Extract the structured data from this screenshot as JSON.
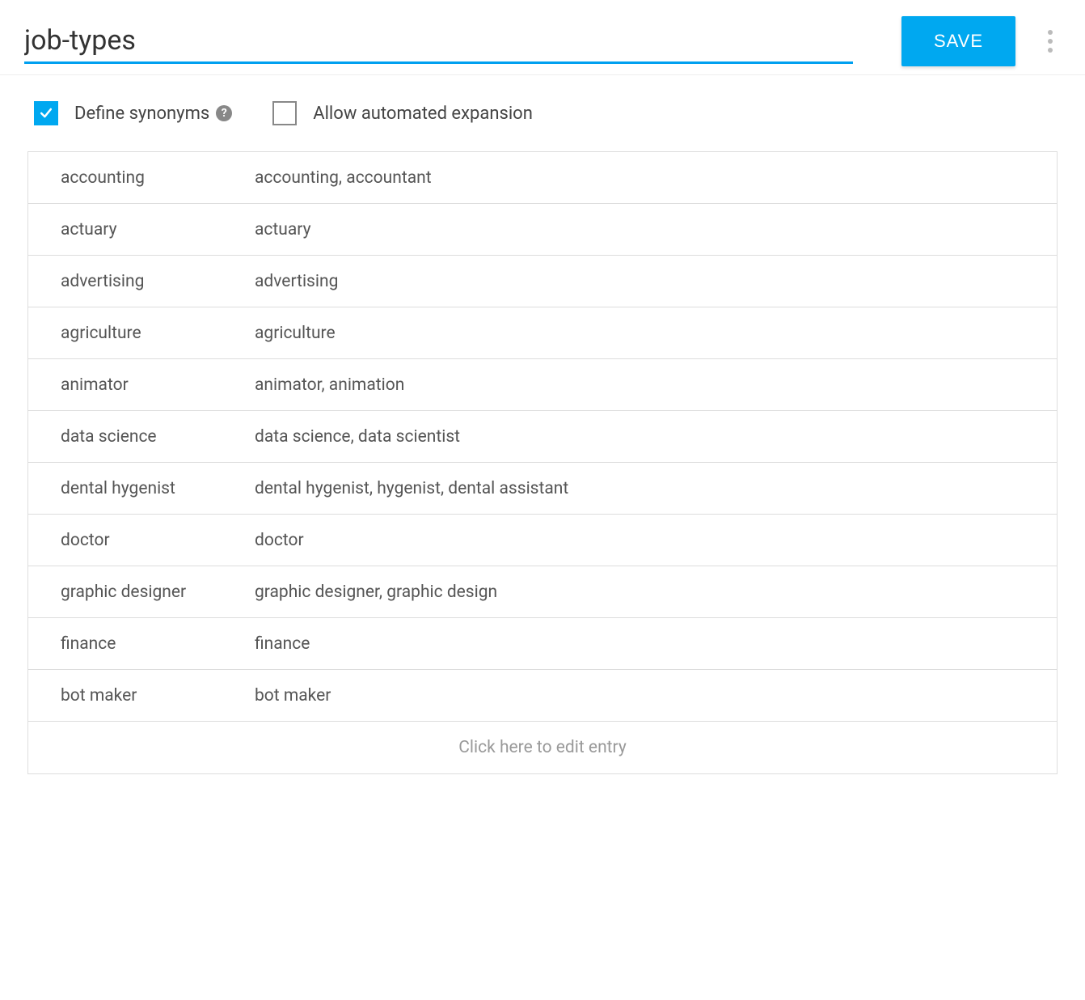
{
  "header": {
    "title_value": "job-types",
    "save_label": "SAVE"
  },
  "options": {
    "define_synonyms": {
      "label": "Define synonyms",
      "checked": true,
      "help": true
    },
    "allow_automated_expansion": {
      "label": "Allow automated expansion",
      "checked": false
    }
  },
  "entries": [
    {
      "key": "accounting",
      "synonyms": "accounting, accountant"
    },
    {
      "key": "actuary",
      "synonyms": "actuary"
    },
    {
      "key": "advertising",
      "synonyms": "advertising"
    },
    {
      "key": "agriculture",
      "synonyms": "agriculture"
    },
    {
      "key": "animator",
      "synonyms": "animator, animation"
    },
    {
      "key": "data science",
      "synonyms": "data science, data scientist"
    },
    {
      "key": "dental hygenist",
      "synonyms": "dental hygenist, hygenist, dental assistant"
    },
    {
      "key": "doctor",
      "synonyms": "doctor"
    },
    {
      "key": "graphic designer",
      "synonyms": "graphic designer, graphic design"
    },
    {
      "key": "finance",
      "synonyms": "finance"
    },
    {
      "key": "bot maker",
      "synonyms": "bot maker"
    }
  ],
  "add_entry_text": "Click here to edit entry"
}
